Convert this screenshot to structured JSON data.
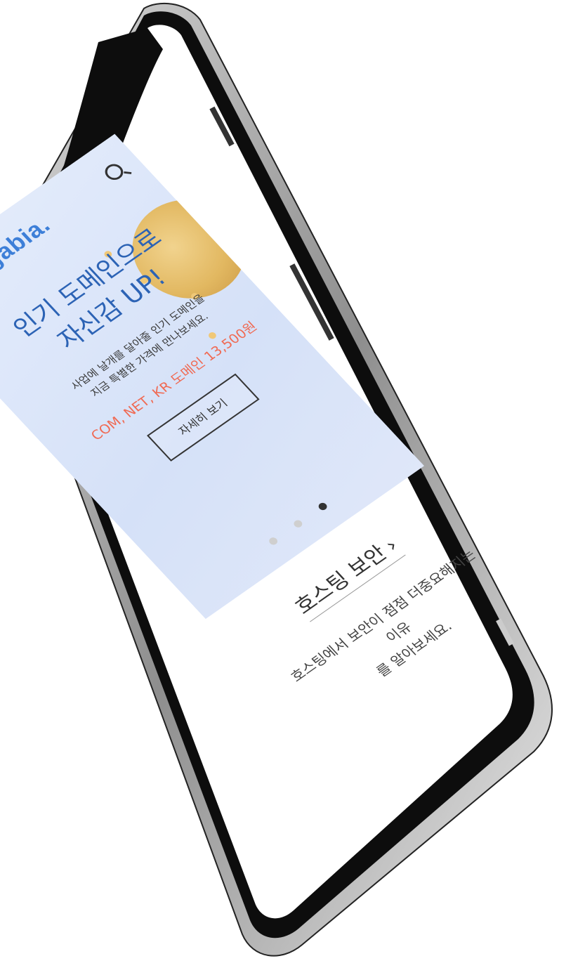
{
  "app": {
    "logo_text": "gabia."
  },
  "banner": {
    "headline_line1": "인기 도메인으로",
    "headline_line2": "자신감 UP!",
    "sub_line1": "사업에 날개를 달아줄 인기 도메인을",
    "sub_line2": "지금 특별한 가격에 만나보세요.",
    "price_text": "COM, NET, KR 도메인 13,500원",
    "cta_label": "자세히 보기"
  },
  "pager": {
    "count": 3,
    "active_index": 2
  },
  "section": {
    "title": "호스팅 보안",
    "chevron": "›",
    "desc_line1": "호스팅에서 보안이 점점 더중요해지는 이유",
    "desc_line2": "를 알아보세요."
  },
  "icons": {
    "menu": "hamburger-menu-icon",
    "search": "search-icon"
  },
  "colors": {
    "brand_blue": "#3d7fd8",
    "headline_blue": "#2c63b5",
    "price_red": "#f06a53",
    "coin_gold": "#e2b861",
    "banner_bg": "#dbe5f9"
  }
}
